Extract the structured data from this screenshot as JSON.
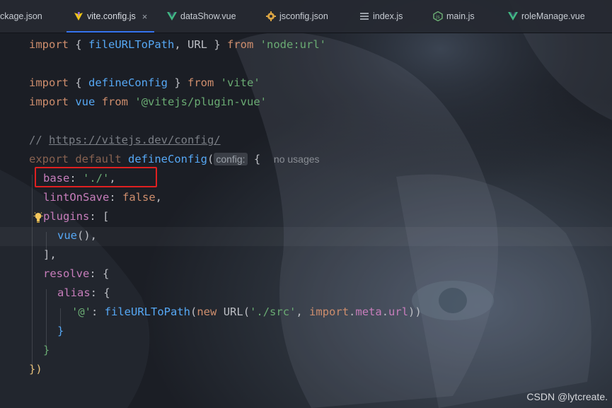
{
  "tabs": [
    {
      "label": "ckage.json",
      "icon": "json-file-icon",
      "active": false
    },
    {
      "label": "vite.config.js",
      "icon": "vite-icon",
      "active": true
    },
    {
      "label": "dataShow.vue",
      "icon": "vue-icon",
      "active": false
    },
    {
      "label": "jsconfig.json",
      "icon": "gear-icon",
      "active": false
    },
    {
      "label": "index.js",
      "icon": "js-file-icon",
      "active": false
    },
    {
      "label": "main.js",
      "icon": "node-icon",
      "active": false
    },
    {
      "label": "roleManage.vue",
      "icon": "vue-icon",
      "active": false
    }
  ],
  "close_glyph": "×",
  "code": {
    "l1": {
      "t1": "import",
      "t2": " { ",
      "t3": "fileURLToPath",
      "t4": ", ",
      "t5": "URL",
      "t6": " } ",
      "t7": "from",
      "t8": " ",
      "t9": "'node:url'"
    },
    "l3": {
      "t1": "import",
      "t2": " { ",
      "t3": "defineConfig",
      "t4": " } ",
      "t5": "from",
      "t6": " ",
      "t7": "'vite'"
    },
    "l4": {
      "t1": "import",
      "t2": " ",
      "t3": "vue",
      "t4": " ",
      "t5": "from",
      "t6": " ",
      "t7": "'@vitejs/plugin-vue'"
    },
    "l6": {
      "t1": "// ",
      "t2": "https://vitejs.dev/config/"
    },
    "l7": {
      "t1": "export default",
      "t2": " ",
      "t3": "defineConfig",
      "t4": "(",
      "hint": "config:",
      "t5": " {",
      "usages": "no usages"
    },
    "l8": {
      "t1": "base",
      "t2": ": ",
      "t3": "'./'",
      "t4": ","
    },
    "l9": {
      "t1": "lintOnSave",
      "t2": ": ",
      "t3": "false",
      "t4": ","
    },
    "l10": {
      "t1": "plugins",
      "t2": ": ["
    },
    "l11": {
      "t1": "vue",
      "t2": "(),"
    },
    "l12": {
      "t1": "],"
    },
    "l13": {
      "t1": "resolve",
      "t2": ": {"
    },
    "l14": {
      "t1": "alias",
      "t2": ": {"
    },
    "l15": {
      "t1": "'@'",
      "t2": ": ",
      "t3": "fileURLToPath",
      "t4": "(",
      "t5": "new",
      "t6": " ",
      "t7": "URL",
      "t8": "(",
      "t9": "'./src'",
      "t10": ", ",
      "t11": "import",
      "t12": ".",
      "t13": "meta",
      "t14": ".",
      "t15": "url",
      "t16": "))"
    },
    "l16": {
      "t1": "}"
    },
    "l17": {
      "t1": "}"
    },
    "l18": {
      "t1": "})"
    }
  },
  "watermark": "CSDN @lytcreate.",
  "colors": {
    "keyword": "#cf8e6d",
    "function": "#56a8f5",
    "string": "#6aab73",
    "property": "#c77dbb",
    "comment": "#7a7e85",
    "highlight_box": "#e02020",
    "active_tab_underline": "#3574f0"
  }
}
